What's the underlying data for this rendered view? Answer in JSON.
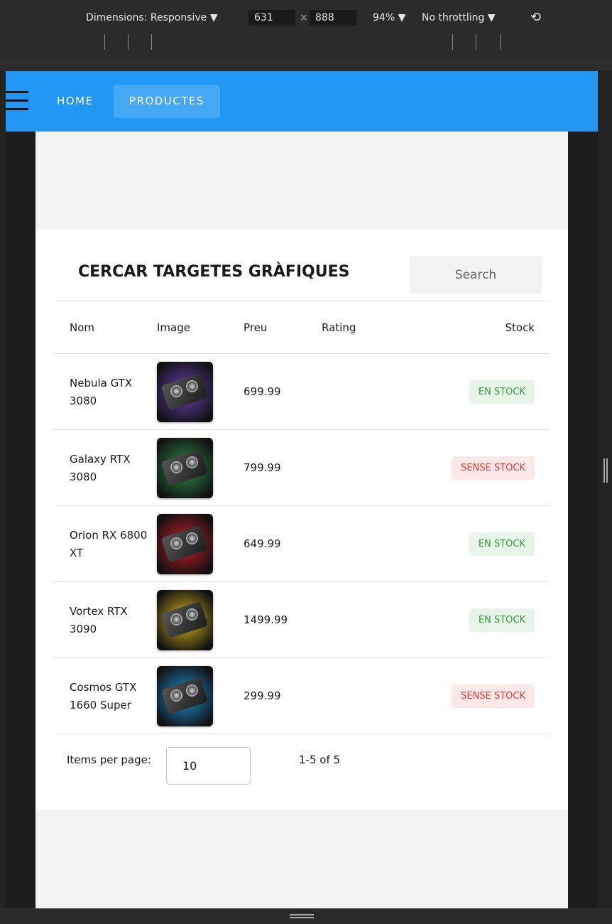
{
  "devtools": {
    "dimensions_label": "Dimensions: Responsive ▼",
    "width": "631",
    "times": "×",
    "height": "888",
    "zoom": "94% ▼",
    "throttling": "No throttling ▼"
  },
  "nav": {
    "home": "HOME",
    "products": "PRODUCTES"
  },
  "main": {
    "title": "CERCAR TARGETES GRÀFIQUES",
    "search_placeholder": "Search"
  },
  "table": {
    "headers": {
      "name": "Nom",
      "image": "Image",
      "price": "Preu",
      "rating": "Rating",
      "stock": "Stock"
    },
    "rows": [
      {
        "name": "Nebula GTX 3080",
        "price": "699.99",
        "stock": "EN STOCK",
        "in_stock": true,
        "color": "#6a3fb5"
      },
      {
        "name": "Galaxy RTX 3080",
        "price": "799.99",
        "stock": "SENSE STOCK",
        "in_stock": false,
        "color": "#2f8f4a"
      },
      {
        "name": "Orion RX 6800 XT",
        "price": "649.99",
        "stock": "EN STOCK",
        "in_stock": true,
        "color": "#c81e2a"
      },
      {
        "name": "Vortex RTX 3090",
        "price": "1499.99",
        "stock": "EN STOCK",
        "in_stock": true,
        "color": "#d9b51e"
      },
      {
        "name": "Cosmos GTX 1660 Super",
        "price": "299.99",
        "stock": "SENSE STOCK",
        "in_stock": false,
        "color": "#1f8fd6"
      }
    ]
  },
  "pagination": {
    "items_per_page_label": "Items per page:",
    "items_per_page_value": "10",
    "range": "1-5 of 5"
  },
  "colors": {
    "navbar": "#2196f3",
    "in_stock": "#2e9c3a",
    "out_of_stock": "#e53935"
  }
}
